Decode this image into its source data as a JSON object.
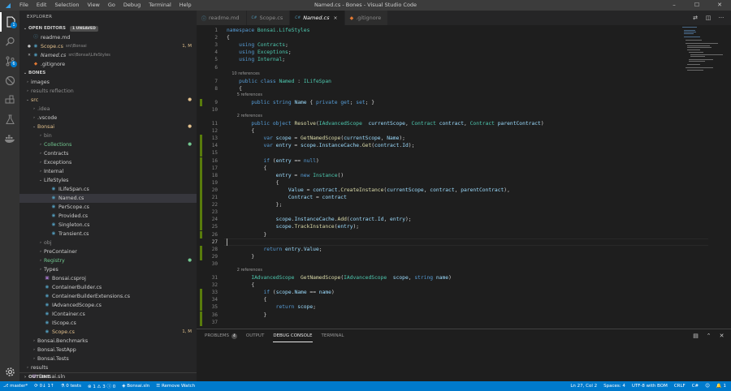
{
  "window": {
    "title": "Named.cs - Bones - Visual Studio Code",
    "logo_icon": "vscode-logo-icon"
  },
  "menu": [
    "File",
    "Edit",
    "Selection",
    "View",
    "Go",
    "Debug",
    "Terminal",
    "Help"
  ],
  "activity": {
    "explorer_badge": "1",
    "scm_badge": "6"
  },
  "sidebar": {
    "title": "EXPLORER",
    "open_editors": {
      "label": "OPEN EDITORS",
      "badge": "1 UNSAVED",
      "items": [
        {
          "marker": "",
          "name": "readme.md",
          "path": "",
          "status": ""
        },
        {
          "marker": "●",
          "name": "Scope.cs",
          "path": "src\\Bonsai",
          "status": "1, M"
        },
        {
          "marker": "✕",
          "name": "Named.cs",
          "path": "src\\Bonsai\\LifeStyles",
          "status": ""
        },
        {
          "marker": "",
          "name": ".gitignore",
          "path": "",
          "status": ""
        }
      ]
    },
    "workspace_label": "BONES",
    "tree": [
      {
        "label": "images",
        "chev": "›",
        "indent": 0,
        "kind": "folder",
        "color": "",
        "badge": ""
      },
      {
        "label": "results reflection",
        "chev": "›",
        "indent": 0,
        "kind": "folder",
        "color": "gray",
        "badge": ""
      },
      {
        "label": "src",
        "chev": "⌄",
        "indent": 0,
        "kind": "folder",
        "color": "red",
        "badge": "●"
      },
      {
        "label": ".idea",
        "chev": "›",
        "indent": 1,
        "kind": "folder",
        "color": "gray",
        "badge": ""
      },
      {
        "label": ".vscode",
        "chev": "›",
        "indent": 1,
        "kind": "folder",
        "color": "",
        "badge": ""
      },
      {
        "label": "Bonsai",
        "chev": "⌄",
        "indent": 1,
        "kind": "folder",
        "color": "red",
        "badge": "●"
      },
      {
        "label": "bin",
        "chev": "›",
        "indent": 2,
        "kind": "folder",
        "color": "gray",
        "badge": ""
      },
      {
        "label": "Collections",
        "chev": "›",
        "indent": 2,
        "kind": "folder",
        "color": "green",
        "badge": "●"
      },
      {
        "label": "Contracts",
        "chev": "›",
        "indent": 2,
        "kind": "folder",
        "color": "",
        "badge": ""
      },
      {
        "label": "Exceptions",
        "chev": "›",
        "indent": 2,
        "kind": "folder",
        "color": "",
        "badge": ""
      },
      {
        "label": "Internal",
        "chev": "›",
        "indent": 2,
        "kind": "folder",
        "color": "",
        "badge": ""
      },
      {
        "label": "LifeStyles",
        "chev": "⌄",
        "indent": 2,
        "kind": "folder",
        "color": "",
        "badge": ""
      },
      {
        "label": "ILifeSpan.cs",
        "chev": "",
        "indent": 3,
        "kind": "cs",
        "color": "",
        "badge": ""
      },
      {
        "label": "Named.cs",
        "chev": "",
        "indent": 3,
        "kind": "cs",
        "color": "",
        "badge": "",
        "selected": true
      },
      {
        "label": "PerScope.cs",
        "chev": "",
        "indent": 3,
        "kind": "cs",
        "color": "",
        "badge": ""
      },
      {
        "label": "Provided.cs",
        "chev": "",
        "indent": 3,
        "kind": "cs",
        "color": "",
        "badge": ""
      },
      {
        "label": "Singleton.cs",
        "chev": "",
        "indent": 3,
        "kind": "cs",
        "color": "",
        "badge": ""
      },
      {
        "label": "Transient.cs",
        "chev": "",
        "indent": 3,
        "kind": "cs",
        "color": "",
        "badge": ""
      },
      {
        "label": "obj",
        "chev": "›",
        "indent": 2,
        "kind": "folder",
        "color": "gray",
        "badge": ""
      },
      {
        "label": "PreContainer",
        "chev": "›",
        "indent": 2,
        "kind": "folder",
        "color": "",
        "badge": ""
      },
      {
        "label": "Registry",
        "chev": "›",
        "indent": 2,
        "kind": "folder",
        "color": "green",
        "badge": "●"
      },
      {
        "label": "Types",
        "chev": "›",
        "indent": 2,
        "kind": "folder",
        "color": "",
        "badge": ""
      },
      {
        "label": "Bonsai.csproj",
        "chev": "",
        "indent": 2,
        "kind": "proj",
        "color": "",
        "badge": ""
      },
      {
        "label": "ContainerBuilder.cs",
        "chev": "",
        "indent": 2,
        "kind": "cs",
        "color": "",
        "badge": ""
      },
      {
        "label": "ContainerBuilderExtensions.cs",
        "chev": "",
        "indent": 2,
        "kind": "cs",
        "color": "",
        "badge": ""
      },
      {
        "label": "IAdvancedScope.cs",
        "chev": "",
        "indent": 2,
        "kind": "cs",
        "color": "",
        "badge": ""
      },
      {
        "label": "IContainer.cs",
        "chev": "",
        "indent": 2,
        "kind": "cs",
        "color": "",
        "badge": ""
      },
      {
        "label": "IScope.cs",
        "chev": "",
        "indent": 2,
        "kind": "cs",
        "color": "",
        "badge": ""
      },
      {
        "label": "Scope.cs",
        "chev": "",
        "indent": 2,
        "kind": "cs",
        "color": "red",
        "badge": "1, M"
      },
      {
        "label": "Bonsai.Benchmarks",
        "chev": "›",
        "indent": 1,
        "kind": "folder",
        "color": "",
        "badge": ""
      },
      {
        "label": "Bonsai.TestApp",
        "chev": "›",
        "indent": 1,
        "kind": "folder",
        "color": "",
        "badge": ""
      },
      {
        "label": "Bonsai.Tests",
        "chev": "›",
        "indent": 1,
        "kind": "folder",
        "color": "",
        "badge": ""
      },
      {
        "label": "results",
        "chev": "›",
        "indent": 0,
        "kind": "folder",
        "color": "",
        "badge": ""
      },
      {
        "label": "Bonsai.sln",
        "chev": "",
        "indent": 0,
        "kind": "sln",
        "color": "",
        "badge": ""
      }
    ],
    "outline_label": "OUTLINE"
  },
  "tabs": [
    {
      "label": "readme.md",
      "icon": "ⓘ",
      "active": false,
      "close": ""
    },
    {
      "label": "Scope.cs",
      "icon": "C#",
      "active": false,
      "close": ""
    },
    {
      "label": "Named.cs",
      "icon": "C#",
      "active": true,
      "close": "×"
    },
    {
      "label": ".gitignore",
      "icon": "◆",
      "active": false,
      "close": ""
    }
  ],
  "editor": {
    "current_line": 27,
    "lines": [
      {
        "n": 1,
        "lens": false,
        "mark": false,
        "html": "<span class='kw'>namespace</span> <span class='ty'>Bonsai.LifeStyles</span>"
      },
      {
        "n": 2,
        "lens": false,
        "mark": false,
        "html": "{"
      },
      {
        "n": 3,
        "lens": false,
        "mark": false,
        "html": "    <span class='kw'>using</span> <span class='ty'>Contracts</span>;"
      },
      {
        "n": 4,
        "lens": false,
        "mark": false,
        "html": "    <span class='kw'>using</span> <span class='ty'>Exceptions</span>;"
      },
      {
        "n": 5,
        "lens": false,
        "mark": false,
        "html": "    <span class='kw'>using</span> <span class='ty'>Internal</span>;"
      },
      {
        "n": 6,
        "lens": false,
        "mark": false,
        "html": ""
      },
      {
        "n": null,
        "lens": true,
        "mark": false,
        "html": "    10 references"
      },
      {
        "n": 7,
        "lens": false,
        "mark": false,
        "html": "    <span class='kw'>public class</span> <span class='ty'>Named</span> : <span class='ty'>ILifeSpan</span>"
      },
      {
        "n": 8,
        "lens": false,
        "mark": false,
        "html": "    {"
      },
      {
        "n": null,
        "lens": true,
        "mark": false,
        "html": "        5 references"
      },
      {
        "n": 9,
        "lens": false,
        "mark": true,
        "html": "        <span class='kw'>public string</span> <span class='pr'>Name</span> { <span class='kw'>private get</span>; <span class='kw'>set</span>; }"
      },
      {
        "n": 10,
        "lens": false,
        "mark": false,
        "html": ""
      },
      {
        "n": null,
        "lens": true,
        "mark": false,
        "html": "        2 references"
      },
      {
        "n": 11,
        "lens": false,
        "mark": false,
        "html": "        <span class='kw'>public object</span> <span class='fn'>Resolve</span>(<span class='ty'>IAdvancedScope</span>  <span class='pr'>currentScope</span>, <span class='ty'>Contract</span> <span class='pr'>contract</span>, <span class='ty'>Contract</span> <span class='pr'>parentContract</span>)"
      },
      {
        "n": 12,
        "lens": false,
        "mark": false,
        "html": "        {"
      },
      {
        "n": 13,
        "lens": false,
        "mark": true,
        "html": "            <span class='kw'>var</span> <span class='pr'>scope</span> = <span class='fn'>GetNamedScope</span>(<span class='pr'>currentScope</span>, <span class='pr'>Name</span>);"
      },
      {
        "n": 14,
        "lens": false,
        "mark": true,
        "html": "            <span class='kw'>var</span> <span class='pr'>entry</span> = <span class='pr'>scope</span>.<span class='pr'>InstanceCache</span>.<span class='fn'>Get</span>(<span class='pr'>contract</span>.<span class='pr'>Id</span>);"
      },
      {
        "n": 15,
        "lens": false,
        "mark": true,
        "html": ""
      },
      {
        "n": 16,
        "lens": false,
        "mark": true,
        "html": "            <span class='kw'>if</span> (<span class='pr'>entry</span> == <span class='kw'>null</span>)"
      },
      {
        "n": 17,
        "lens": false,
        "mark": true,
        "html": "            {"
      },
      {
        "n": 18,
        "lens": false,
        "mark": true,
        "html": "                <span class='pr'>entry</span> = <span class='kw'>new</span> <span class='ty'>Instance</span>()"
      },
      {
        "n": 19,
        "lens": false,
        "mark": true,
        "html": "                {"
      },
      {
        "n": 20,
        "lens": false,
        "mark": true,
        "html": "                    <span class='pr'>Value</span> = <span class='pr'>contract</span>.<span class='fn'>CreateInstance</span>(<span class='pr'>currentScope</span>, <span class='pr'>contract</span>, <span class='pr'>parentContract</span>),"
      },
      {
        "n": 21,
        "lens": false,
        "mark": true,
        "html": "                    <span class='pr'>Contract</span> = <span class='pr'>contract</span>"
      },
      {
        "n": 22,
        "lens": false,
        "mark": true,
        "html": "                };"
      },
      {
        "n": 23,
        "lens": false,
        "mark": true,
        "html": ""
      },
      {
        "n": 24,
        "lens": false,
        "mark": true,
        "html": "                <span class='pr'>scope</span>.<span class='pr'>InstanceCache</span>.<span class='fn'>Add</span>(<span class='pr'>contract</span>.<span class='pr'>Id</span>, <span class='pr'>entry</span>);"
      },
      {
        "n": 25,
        "lens": false,
        "mark": true,
        "html": "                <span class='pr'>scope</span>.<span class='fn'>TrackInstance</span>(<span class='pr'>entry</span>);"
      },
      {
        "n": 26,
        "lens": false,
        "mark": true,
        "html": "            }"
      },
      {
        "n": 27,
        "lens": false,
        "mark": false,
        "html": ""
      },
      {
        "n": 28,
        "lens": false,
        "mark": true,
        "html": "            <span class='kw'>return</span> <span class='pr'>entry</span>.<span class='pr'>Value</span>;"
      },
      {
        "n": 29,
        "lens": false,
        "mark": true,
        "html": "        }"
      },
      {
        "n": 30,
        "lens": false,
        "mark": false,
        "html": ""
      },
      {
        "n": null,
        "lens": true,
        "mark": false,
        "html": "        2 references"
      },
      {
        "n": 31,
        "lens": false,
        "mark": false,
        "html": "        <span class='ty'>IAdvancedScope</span>  <span class='fn'>GetNamedScope</span>(<span class='ty'>IAdvancedScope</span>  <span class='pr'>scope</span>, <span class='kw'>string</span> <span class='pr'>name</span>)"
      },
      {
        "n": 32,
        "lens": false,
        "mark": false,
        "html": "        {"
      },
      {
        "n": 33,
        "lens": false,
        "mark": true,
        "html": "            <span class='kw'>if</span> (<span class='pr'>scope</span>.<span class='pr'>Name</span> == <span class='pr'>name</span>)"
      },
      {
        "n": 34,
        "lens": false,
        "mark": true,
        "html": "            {"
      },
      {
        "n": 35,
        "lens": false,
        "mark": true,
        "html": "                <span class='kw'>return</span> <span class='pr'>scope</span>;"
      },
      {
        "n": 36,
        "lens": false,
        "mark": true,
        "html": "            }"
      },
      {
        "n": 37,
        "lens": false,
        "mark": true,
        "html": ""
      }
    ]
  },
  "panel": {
    "tabs": [
      {
        "label": "PROBLEMS",
        "count": "4",
        "active": false
      },
      {
        "label": "OUTPUT",
        "count": "",
        "active": false
      },
      {
        "label": "DEBUG CONSOLE",
        "count": "",
        "active": true
      },
      {
        "label": "TERMINAL",
        "count": "",
        "active": false
      }
    ]
  },
  "status": {
    "branch": "master*",
    "sync": "0↓ 1↑",
    "tests": "0 tests",
    "errors": "1",
    "warnings": "3",
    "info": "0",
    "solution": "Bonsai.sln",
    "remove_watch": "Remove Watch",
    "position": "Ln 27, Col 2",
    "spaces": "Spaces: 4",
    "encoding": "UTF-8 with BOM",
    "eol": "CRLF",
    "language": "C#",
    "notifications": "1"
  },
  "colors": {
    "statusbar": "#007acc",
    "activitybar": "#333333",
    "sidebar": "#252526",
    "editor": "#1e1e1e",
    "gutter_modified": "#587c0c"
  }
}
